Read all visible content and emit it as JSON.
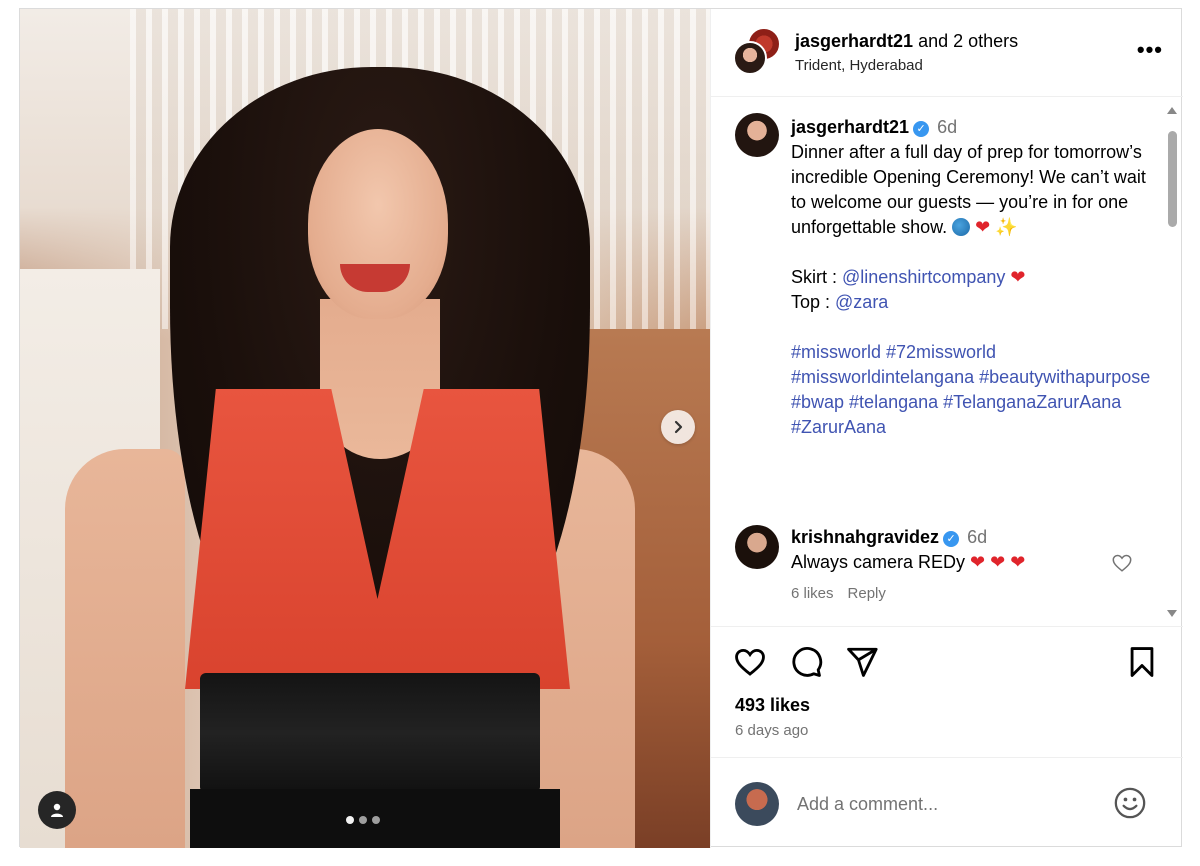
{
  "header": {
    "username": "jasgerhardt21",
    "and_others": " and 2 others",
    "location": "Trident, Hyderabad",
    "more_label": "•••"
  },
  "caption": {
    "username": "jasgerhardt21",
    "time": "6d",
    "line1": "Dinner after a full day of prep for tomorrow’s incredible Opening Ceremony! We can’t wait to welcome our guests — you’re in for one unforgettable show.",
    "skirt_label": "Skirt : ",
    "skirt_link": "@linenshirtcompany",
    "top_label": "Top : ",
    "top_link": "@zara",
    "hashtags": "#missworld #72missworld #missworldintelangana #beautywithapurpose #bwap #telangana #TelanganaZarurAana #ZarurAana"
  },
  "comment": {
    "username": "krishnahgravidez",
    "time": "6d",
    "text": "Always camera REDy",
    "likes": "6 likes",
    "reply": "Reply"
  },
  "post": {
    "likes": "493 likes",
    "ago": "6 days ago"
  },
  "comment_box": {
    "placeholder": "Add a comment..."
  },
  "icons": {
    "verified": "verified-badge",
    "heart": "heart-icon",
    "comment": "comment-icon",
    "share": "share-icon",
    "save": "bookmark-icon",
    "emoji": "emoji-icon"
  },
  "colors": {
    "link": "#4054b2",
    "verified": "#3897f0",
    "muted": "#737373"
  }
}
